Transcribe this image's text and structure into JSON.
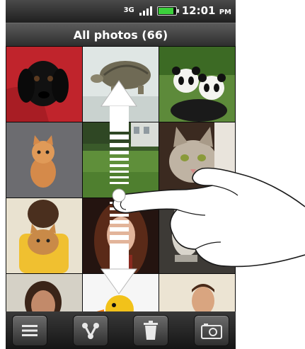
{
  "status_bar": {
    "network_label": "3G",
    "time": "12:01",
    "ampm": "PM",
    "battery_color": "#3cd13c"
  },
  "header": {
    "title": "All photos (66)"
  },
  "photos": [
    {
      "subject": "black-puppy"
    },
    {
      "subject": "tortoise"
    },
    {
      "subject": "pandas"
    },
    {
      "subject": "orange-kitten"
    },
    {
      "subject": "garden"
    },
    {
      "subject": "tabby-cat"
    },
    {
      "subject": "girl-with-cat"
    },
    {
      "subject": "woman-portrait"
    },
    {
      "subject": "cat-statue"
    },
    {
      "subject": "smiling-woman"
    },
    {
      "subject": "rubber-duck"
    },
    {
      "subject": "man-portrait"
    }
  ],
  "toolbar": {
    "buttons": [
      {
        "icon": "menu-icon"
      },
      {
        "icon": "share-icon"
      },
      {
        "icon": "trash-icon"
      },
      {
        "icon": "camera-icon"
      }
    ]
  },
  "gesture": {
    "type": "vertical-swipe",
    "direction": "up-down"
  }
}
